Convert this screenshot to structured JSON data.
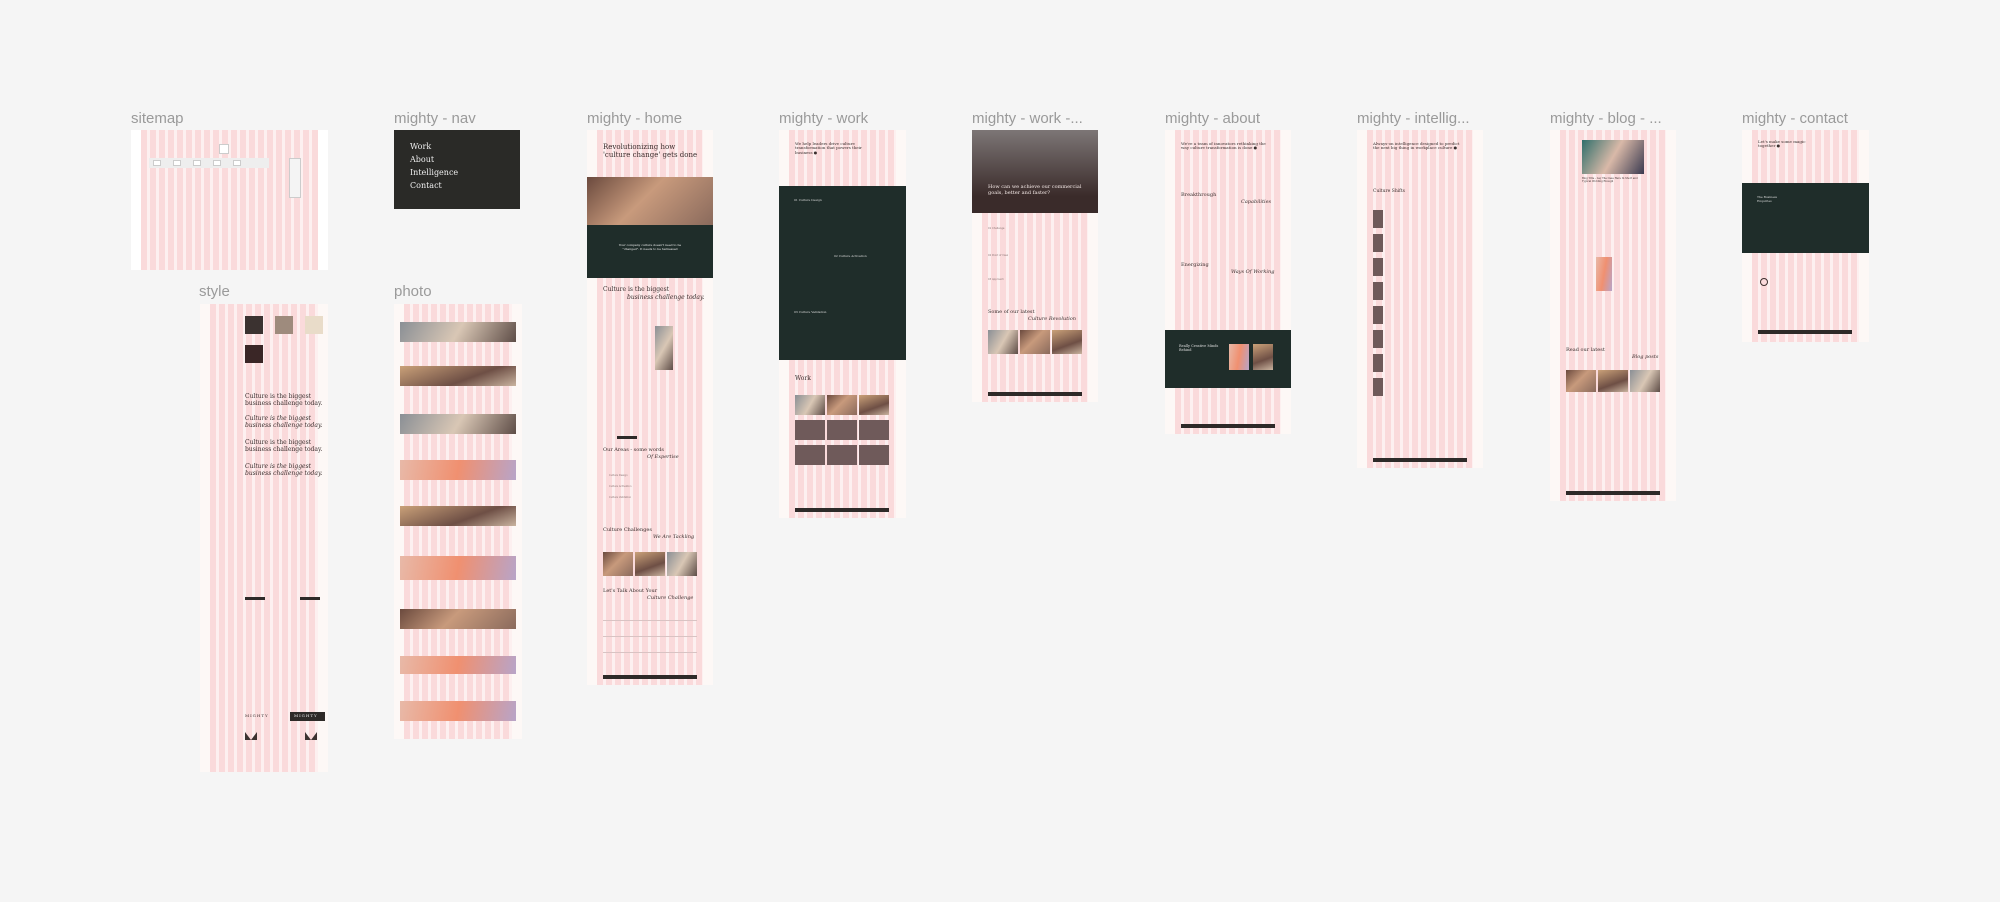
{
  "canvas": {
    "background": "#f5f5f5"
  },
  "frames": {
    "sitemap": {
      "label": "sitemap"
    },
    "style": {
      "label": "style",
      "swatches": [
        "#3b3230",
        "#9e8b7d",
        "#e9dcc9",
        "#3a2626"
      ],
      "sample_heading": "Culture is the biggest business challenge today.",
      "logo": "MIGHTY"
    },
    "nav": {
      "label": "mighty - nav",
      "items": [
        "Work",
        "About",
        "Intelligence",
        "Contact"
      ]
    },
    "photo": {
      "label": "photo"
    },
    "home": {
      "label": "mighty - home",
      "hero_1": "Revolutionizing how",
      "hero_2": "'culture change' gets done",
      "quote": "Your company culture doesn't need to be \"changed\". It needs to be harnessed",
      "culture_1": "Culture is the biggest",
      "culture_2": "business challenge today.",
      "areas_1": "Our Areas - some words",
      "areas_2": "Of Expertise",
      "areas": [
        "Culture Design",
        "Culture Activation",
        "Culture Validation"
      ],
      "challenges_1": "Culture Challenges",
      "challenges_2": "We Are Tackling",
      "talk_1": "Let's Talk About Your",
      "talk_2": "Culture Challenge"
    },
    "work": {
      "label": "mighty - work",
      "hero": "We help leaders drive culture transformation that powers their business ●",
      "services": [
        "01 Culture Design",
        "02 Culture Activation",
        "03 Culture Validation"
      ],
      "section": "Work"
    },
    "work_detail": {
      "label": "mighty - work -...",
      "hero": "How can we achieve our commercial goals, better and faster?",
      "items": [
        "01 Challenge",
        "02 Point of View",
        "03 Approach"
      ],
      "latest_1": "Some of our latest",
      "latest_2": "Culture Revolution"
    },
    "about": {
      "label": "mighty - about",
      "hero": "We're a team of innovators rethinking the way culture transformation is done ●",
      "h1a": "Breakthrough",
      "h1b": "Capabilities",
      "h2a": "Energizing",
      "h2b": "Ways Of Working",
      "team": "Really Creative Minds Behind"
    },
    "intelligence": {
      "label": "mighty - intellig...",
      "hero": "Always-on intelligence designed to predict the next big thing in workplace culture ●",
      "section": "Culture Shifts"
    },
    "blog": {
      "label": "mighty - blog - ...",
      "title": "Blog Title - Lay The Case Here In Short and Typical Wording Enough",
      "read_1": "Read our latest",
      "read_2": "Blog posts"
    },
    "contact": {
      "label": "mighty - contact",
      "hero": "Let's make some magic together ●",
      "dark_title": "The Business Enquiries"
    }
  }
}
